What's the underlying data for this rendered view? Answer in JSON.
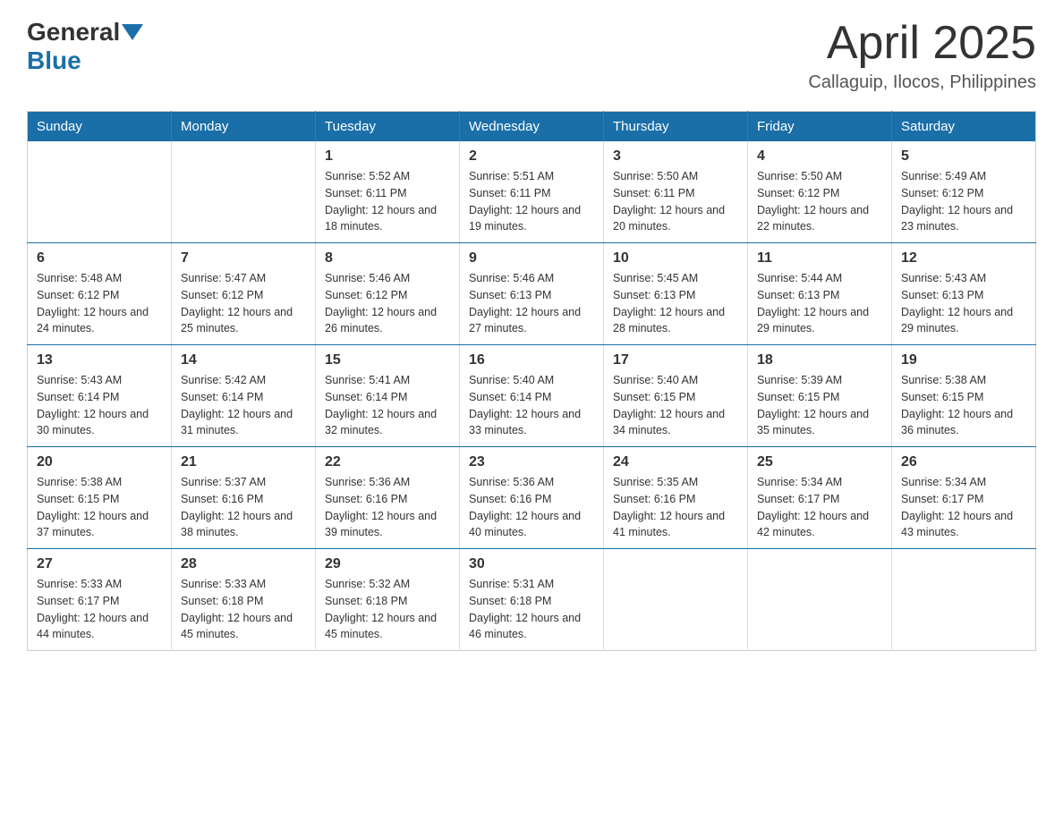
{
  "header": {
    "logo_general": "General",
    "logo_blue": "Blue",
    "month_title": "April 2025",
    "location": "Callaguip, Ilocos, Philippines"
  },
  "weekdays": [
    "Sunday",
    "Monday",
    "Tuesday",
    "Wednesday",
    "Thursday",
    "Friday",
    "Saturday"
  ],
  "weeks": [
    [
      {
        "day": "",
        "sunrise": "",
        "sunset": "",
        "daylight": ""
      },
      {
        "day": "",
        "sunrise": "",
        "sunset": "",
        "daylight": ""
      },
      {
        "day": "1",
        "sunrise": "Sunrise: 5:52 AM",
        "sunset": "Sunset: 6:11 PM",
        "daylight": "Daylight: 12 hours and 18 minutes."
      },
      {
        "day": "2",
        "sunrise": "Sunrise: 5:51 AM",
        "sunset": "Sunset: 6:11 PM",
        "daylight": "Daylight: 12 hours and 19 minutes."
      },
      {
        "day": "3",
        "sunrise": "Sunrise: 5:50 AM",
        "sunset": "Sunset: 6:11 PM",
        "daylight": "Daylight: 12 hours and 20 minutes."
      },
      {
        "day": "4",
        "sunrise": "Sunrise: 5:50 AM",
        "sunset": "Sunset: 6:12 PM",
        "daylight": "Daylight: 12 hours and 22 minutes."
      },
      {
        "day": "5",
        "sunrise": "Sunrise: 5:49 AM",
        "sunset": "Sunset: 6:12 PM",
        "daylight": "Daylight: 12 hours and 23 minutes."
      }
    ],
    [
      {
        "day": "6",
        "sunrise": "Sunrise: 5:48 AM",
        "sunset": "Sunset: 6:12 PM",
        "daylight": "Daylight: 12 hours and 24 minutes."
      },
      {
        "day": "7",
        "sunrise": "Sunrise: 5:47 AM",
        "sunset": "Sunset: 6:12 PM",
        "daylight": "Daylight: 12 hours and 25 minutes."
      },
      {
        "day": "8",
        "sunrise": "Sunrise: 5:46 AM",
        "sunset": "Sunset: 6:12 PM",
        "daylight": "Daylight: 12 hours and 26 minutes."
      },
      {
        "day": "9",
        "sunrise": "Sunrise: 5:46 AM",
        "sunset": "Sunset: 6:13 PM",
        "daylight": "Daylight: 12 hours and 27 minutes."
      },
      {
        "day": "10",
        "sunrise": "Sunrise: 5:45 AM",
        "sunset": "Sunset: 6:13 PM",
        "daylight": "Daylight: 12 hours and 28 minutes."
      },
      {
        "day": "11",
        "sunrise": "Sunrise: 5:44 AM",
        "sunset": "Sunset: 6:13 PM",
        "daylight": "Daylight: 12 hours and 29 minutes."
      },
      {
        "day": "12",
        "sunrise": "Sunrise: 5:43 AM",
        "sunset": "Sunset: 6:13 PM",
        "daylight": "Daylight: 12 hours and 29 minutes."
      }
    ],
    [
      {
        "day": "13",
        "sunrise": "Sunrise: 5:43 AM",
        "sunset": "Sunset: 6:14 PM",
        "daylight": "Daylight: 12 hours and 30 minutes."
      },
      {
        "day": "14",
        "sunrise": "Sunrise: 5:42 AM",
        "sunset": "Sunset: 6:14 PM",
        "daylight": "Daylight: 12 hours and 31 minutes."
      },
      {
        "day": "15",
        "sunrise": "Sunrise: 5:41 AM",
        "sunset": "Sunset: 6:14 PM",
        "daylight": "Daylight: 12 hours and 32 minutes."
      },
      {
        "day": "16",
        "sunrise": "Sunrise: 5:40 AM",
        "sunset": "Sunset: 6:14 PM",
        "daylight": "Daylight: 12 hours and 33 minutes."
      },
      {
        "day": "17",
        "sunrise": "Sunrise: 5:40 AM",
        "sunset": "Sunset: 6:15 PM",
        "daylight": "Daylight: 12 hours and 34 minutes."
      },
      {
        "day": "18",
        "sunrise": "Sunrise: 5:39 AM",
        "sunset": "Sunset: 6:15 PM",
        "daylight": "Daylight: 12 hours and 35 minutes."
      },
      {
        "day": "19",
        "sunrise": "Sunrise: 5:38 AM",
        "sunset": "Sunset: 6:15 PM",
        "daylight": "Daylight: 12 hours and 36 minutes."
      }
    ],
    [
      {
        "day": "20",
        "sunrise": "Sunrise: 5:38 AM",
        "sunset": "Sunset: 6:15 PM",
        "daylight": "Daylight: 12 hours and 37 minutes."
      },
      {
        "day": "21",
        "sunrise": "Sunrise: 5:37 AM",
        "sunset": "Sunset: 6:16 PM",
        "daylight": "Daylight: 12 hours and 38 minutes."
      },
      {
        "day": "22",
        "sunrise": "Sunrise: 5:36 AM",
        "sunset": "Sunset: 6:16 PM",
        "daylight": "Daylight: 12 hours and 39 minutes."
      },
      {
        "day": "23",
        "sunrise": "Sunrise: 5:36 AM",
        "sunset": "Sunset: 6:16 PM",
        "daylight": "Daylight: 12 hours and 40 minutes."
      },
      {
        "day": "24",
        "sunrise": "Sunrise: 5:35 AM",
        "sunset": "Sunset: 6:16 PM",
        "daylight": "Daylight: 12 hours and 41 minutes."
      },
      {
        "day": "25",
        "sunrise": "Sunrise: 5:34 AM",
        "sunset": "Sunset: 6:17 PM",
        "daylight": "Daylight: 12 hours and 42 minutes."
      },
      {
        "day": "26",
        "sunrise": "Sunrise: 5:34 AM",
        "sunset": "Sunset: 6:17 PM",
        "daylight": "Daylight: 12 hours and 43 minutes."
      }
    ],
    [
      {
        "day": "27",
        "sunrise": "Sunrise: 5:33 AM",
        "sunset": "Sunset: 6:17 PM",
        "daylight": "Daylight: 12 hours and 44 minutes."
      },
      {
        "day": "28",
        "sunrise": "Sunrise: 5:33 AM",
        "sunset": "Sunset: 6:18 PM",
        "daylight": "Daylight: 12 hours and 45 minutes."
      },
      {
        "day": "29",
        "sunrise": "Sunrise: 5:32 AM",
        "sunset": "Sunset: 6:18 PM",
        "daylight": "Daylight: 12 hours and 45 minutes."
      },
      {
        "day": "30",
        "sunrise": "Sunrise: 5:31 AM",
        "sunset": "Sunset: 6:18 PM",
        "daylight": "Daylight: 12 hours and 46 minutes."
      },
      {
        "day": "",
        "sunrise": "",
        "sunset": "",
        "daylight": ""
      },
      {
        "day": "",
        "sunrise": "",
        "sunset": "",
        "daylight": ""
      },
      {
        "day": "",
        "sunrise": "",
        "sunset": "",
        "daylight": ""
      }
    ]
  ]
}
